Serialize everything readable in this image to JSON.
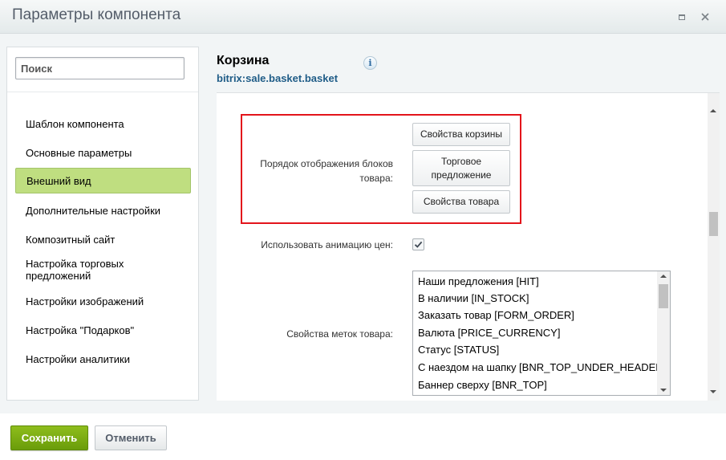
{
  "window": {
    "title": "Параметры компонента",
    "maximize_icon": "maximize-icon",
    "close_icon": "close-icon"
  },
  "sidebar": {
    "search_placeholder": "Поиск",
    "items": [
      {
        "label": "Шаблон компонента",
        "active": false
      },
      {
        "label": "Основные параметры",
        "active": false
      },
      {
        "label": "Внешний вид",
        "active": true
      },
      {
        "label": "Дополнительные настройки",
        "active": false
      },
      {
        "label": "Композитный сайт",
        "active": false
      },
      {
        "label": "Настройка торговых предложений",
        "active": false
      },
      {
        "label": "Настройки изображений",
        "active": false
      },
      {
        "label": "Настройка \"Подарков\"",
        "active": false
      },
      {
        "label": "Настройки аналитики",
        "active": false
      }
    ]
  },
  "component": {
    "title": "Корзина",
    "id": "bitrix:sale.basket.basket",
    "info_icon": "info-icon"
  },
  "settings": {
    "block_order": {
      "label": "Порядок отображения блоков товара:",
      "buttons": [
        "Свойства корзины",
        "Торговое предложение",
        "Свойства товара"
      ]
    },
    "price_animation": {
      "label": "Использовать анимацию цен:",
      "checked": true
    },
    "label_props": {
      "label": "Свойства меток товара:",
      "options": [
        "Наши предложения [HIT]",
        "В наличии [IN_STOCK]",
        "Заказать товар [FORM_ORDER]",
        "Валюта [PRICE_CURRENCY]",
        "Статус [STATUS]",
        "С наездом на шапку [BNR_TOP_UNDER_HEADER]",
        "Баннер сверху [BNR_TOP]"
      ]
    }
  },
  "footer": {
    "save_label": "Сохранить",
    "cancel_label": "Отменить"
  },
  "colors": {
    "accent_green": "#7aac13",
    "active_nav": "#bfde80",
    "highlight": "#e3141b",
    "link_blue": "#1f5c87"
  }
}
